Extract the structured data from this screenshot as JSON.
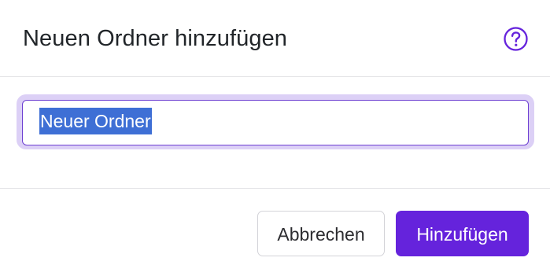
{
  "dialog": {
    "title": "Neuen Ordner hinzufügen",
    "help_icon": "question-circle-icon"
  },
  "form": {
    "folder_name_value": "Neuer Ordner",
    "selected_text": "Neuer Ordner"
  },
  "footer": {
    "cancel_label": "Abbrechen",
    "submit_label": "Hinzufügen"
  },
  "colors": {
    "accent": "#6523dc",
    "focus_ring": "#dcd0f6",
    "selection": "#3e6fd5"
  }
}
